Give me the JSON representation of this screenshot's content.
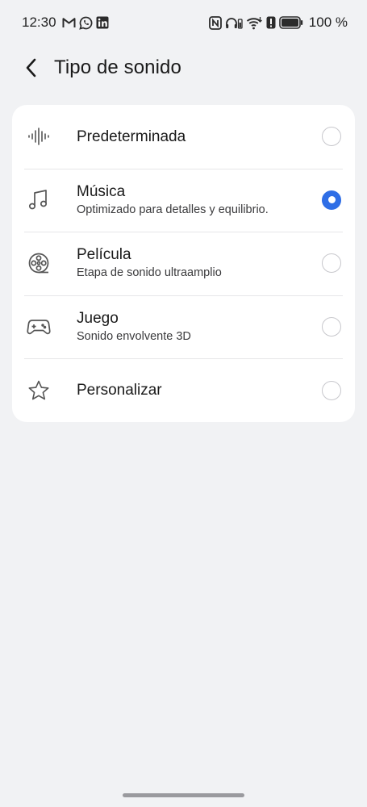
{
  "status_bar": {
    "time": "12:30",
    "left_icons": [
      "gmail-icon",
      "whatsapp-icon",
      "linkedin-icon"
    ],
    "right_icons": [
      "nfc-icon",
      "headphones-battery-icon",
      "wifi-icon",
      "alert-icon",
      "battery-icon"
    ],
    "battery_text": "100 %"
  },
  "header": {
    "back_icon": "chevron-left-icon",
    "title": "Tipo de sonido"
  },
  "options": [
    {
      "icon": "soundwave-icon",
      "title": "Predeterminada",
      "subtitle": "",
      "selected": false
    },
    {
      "icon": "music-note-icon",
      "title": "Música",
      "subtitle": "Optimizado para detalles y equilibrio.",
      "selected": true
    },
    {
      "icon": "film-reel-icon",
      "title": "Película",
      "subtitle": "Etapa de sonido ultraamplio",
      "selected": false
    },
    {
      "icon": "gamepad-icon",
      "title": "Juego",
      "subtitle": "Sonido envolvente 3D",
      "selected": false
    },
    {
      "icon": "star-icon",
      "title": "Personalizar",
      "subtitle": "",
      "selected": false
    }
  ],
  "colors": {
    "accent": "#2f6ee6",
    "background": "#f1f2f4",
    "card": "#ffffff"
  }
}
